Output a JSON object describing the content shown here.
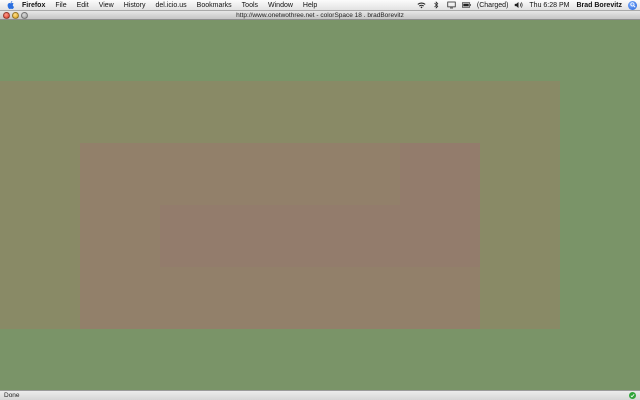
{
  "menubar": {
    "app_name": "Firefox",
    "items": [
      "File",
      "Edit",
      "View",
      "History",
      "del.icio.us",
      "Bookmarks",
      "Tools",
      "Window",
      "Help"
    ],
    "battery_status": "(Charged)",
    "clock": "Thu 6:28 PM",
    "user": "Brad Borevitz",
    "status_icons": [
      "wifi-icon",
      "bluetooth-icon",
      "display-icon",
      "battery-icon",
      "volume-icon"
    ]
  },
  "window": {
    "title": "http://www.onetwothree.net - colorSpace 18 . bradBorevitz"
  },
  "content": {
    "colors": {
      "background": "#7a9468",
      "outer_band": "#898a66",
      "middle_band": "#92806a",
      "inner_band": "#937c6c"
    }
  },
  "statusbar": {
    "status": "Done"
  }
}
